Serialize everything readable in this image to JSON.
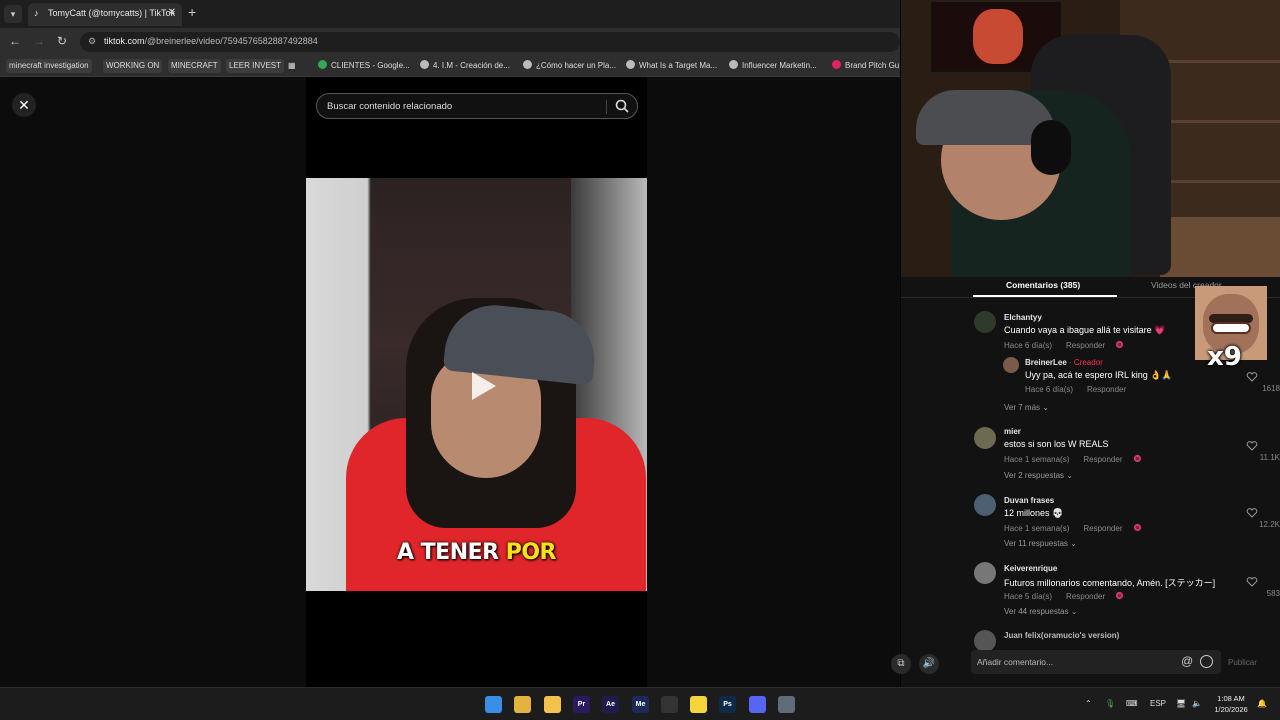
{
  "browser": {
    "tab_title": "TomyCatt (@tomycatts) | TikTok",
    "url_host": "tiktok.com",
    "url_path": "/@breinerlee/video/7594576582887492884",
    "bookmarks": [
      {
        "label": "minecraft investigation",
        "chip": true
      },
      {
        "label": "WORKING ON",
        "chip": true
      },
      {
        "label": "MINECRAFT",
        "chip": true
      },
      {
        "label": "LEER INVEST",
        "chip": true
      },
      {
        "label": "CLIENTES - Google...",
        "chip": false,
        "color": "#34a853"
      },
      {
        "label": "4. I.M - Creación de...",
        "chip": false,
        "color": "#bbbbbb"
      },
      {
        "label": "¿Cómo hacer un Pla...",
        "chip": false,
        "color": "#bbbbbb"
      },
      {
        "label": "What Is a Target Ma...",
        "chip": false,
        "color": "#bbbbbb"
      },
      {
        "label": "Influencer Marketin...",
        "chip": false,
        "color": "#bbbbbb"
      },
      {
        "label": "Brand Pitch Gu",
        "chip": false,
        "color": "#e0245e"
      }
    ]
  },
  "search": {
    "placeholder": "Buscar contenido relacionado"
  },
  "video": {
    "caption_white": "A TENER ",
    "caption_yellow": "POR"
  },
  "comments_panel": {
    "tab_comments": "Comentarios (385)",
    "tab_creator_videos": "Videos del creador",
    "reply_label": "Responder",
    "items": [
      {
        "user": "Elchantyy",
        "text": "Cuando vaya a ibague allá te visitare 💗",
        "time": "Hace 6 día(s)",
        "likes": ""
      },
      {
        "user": "BreinerLee",
        "creator_tag": "· Creador",
        "text": "Uyy pa, acá te espero IRL king 👌🙏",
        "time": "Hace 6 día(s)",
        "likes": "1618"
      },
      {
        "user": "mier",
        "text": "estos si son los W REALS",
        "time": "Hace 1 semana(s)",
        "likes": "11.1K"
      },
      {
        "user": "Duvan frases",
        "text": "12 millones 💀",
        "time": "Hace 1 semana(s)",
        "likes": "12.2K"
      },
      {
        "user": "Keiverenrique",
        "text": "Futuros millonarios comentando, Amén. [ステッカー]",
        "time": "Hace 5 día(s)",
        "likes": "583"
      }
    ],
    "more_links": [
      "Ver 7 más",
      "Ver 2 respuestas",
      "Ver 11 respuestas",
      "Ver 44 respuestas"
    ],
    "partial_user": "Juan felix(oramucio's version)",
    "composer_placeholder": "Añadir comentario...",
    "publish_label": "Publicar"
  },
  "overlay": {
    "meme_text": "x9"
  },
  "taskbar": {
    "apps": [
      {
        "name": "windows-start",
        "label": "",
        "color": "#3a8ee6"
      },
      {
        "name": "chrome",
        "label": "",
        "color": "#e3b341"
      },
      {
        "name": "file-explorer",
        "label": "",
        "color": "#f2c14e"
      },
      {
        "name": "premiere",
        "label": "Pr",
        "color": "#2a1b5e"
      },
      {
        "name": "after-effects",
        "label": "Ae",
        "color": "#1f1c4d"
      },
      {
        "name": "media-encoder",
        "label": "Me",
        "color": "#1c2a5a"
      },
      {
        "name": "obs",
        "label": "",
        "color": "#333333"
      },
      {
        "name": "sticky-notes",
        "label": "",
        "color": "#f5d33b"
      },
      {
        "name": "photoshop",
        "label": "Ps",
        "color": "#0e2a47"
      },
      {
        "name": "discord",
        "label": "",
        "color": "#5865f2"
      },
      {
        "name": "settings",
        "label": "",
        "color": "#5f6b78"
      }
    ],
    "lang": "ESP",
    "time": "1:08 AM",
    "date": "1/20/2026"
  }
}
